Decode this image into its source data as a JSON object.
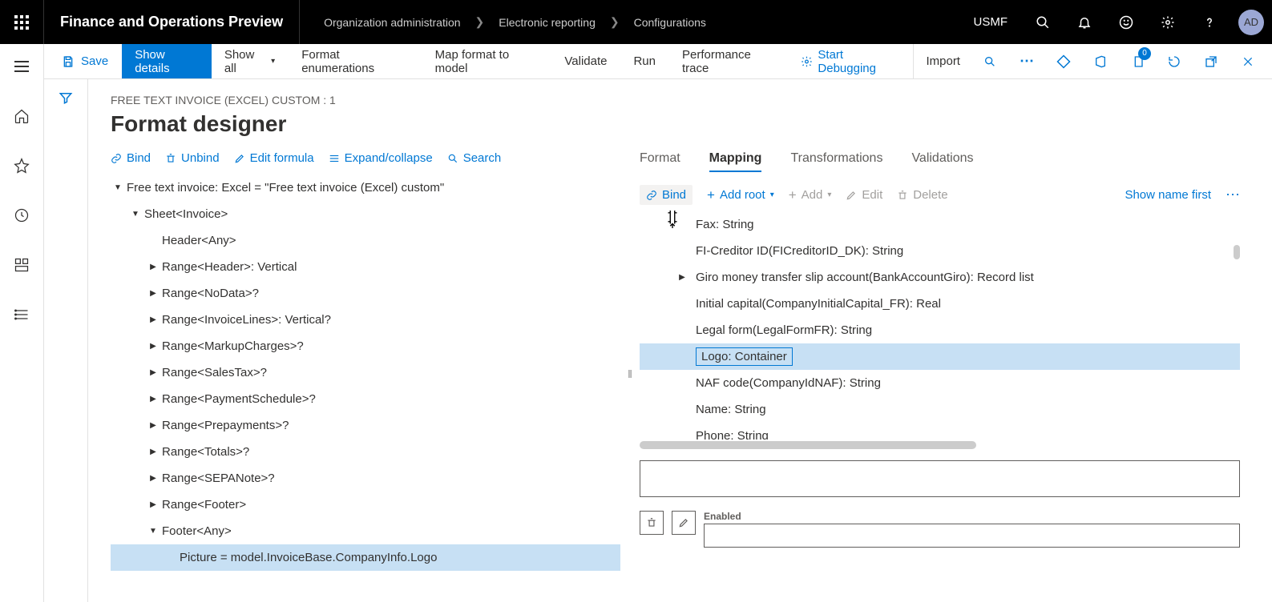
{
  "app": {
    "title": "Finance and Operations Preview",
    "entity": "USMF",
    "avatar": "AD",
    "breadcrumb": [
      "Organization administration",
      "Electronic reporting",
      "Configurations"
    ]
  },
  "cmdbar": {
    "save": "Save",
    "show_details": "Show details",
    "show_all": "Show all",
    "format_enum": "Format enumerations",
    "map_model": "Map format to model",
    "validate": "Validate",
    "run": "Run",
    "perf": "Performance trace",
    "start_debug": "Start Debugging",
    "import": "Import",
    "badge_count": "0"
  },
  "page": {
    "context": "FREE TEXT INVOICE (EXCEL) CUSTOM : 1",
    "title": "Format designer"
  },
  "left_toolbar": {
    "bind": "Bind",
    "unbind": "Unbind",
    "edit_formula": "Edit formula",
    "expand": "Expand/collapse",
    "search": "Search"
  },
  "format_tree": [
    {
      "indent": 0,
      "caret": "down",
      "label": "Free text invoice: Excel = \"Free text invoice (Excel) custom\"",
      "sel": false
    },
    {
      "indent": 1,
      "caret": "down",
      "label": "Sheet<Invoice>",
      "sel": false
    },
    {
      "indent": 2,
      "caret": "",
      "label": "Header<Any>",
      "sel": false
    },
    {
      "indent": 2,
      "caret": "right",
      "label": "Range<Header>: Vertical",
      "sel": false
    },
    {
      "indent": 2,
      "caret": "right",
      "label": "Range<NoData>?",
      "sel": false
    },
    {
      "indent": 2,
      "caret": "right",
      "label": "Range<InvoiceLines>: Vertical?",
      "sel": false
    },
    {
      "indent": 2,
      "caret": "right",
      "label": "Range<MarkupCharges>?",
      "sel": false
    },
    {
      "indent": 2,
      "caret": "right",
      "label": "Range<SalesTax>?",
      "sel": false
    },
    {
      "indent": 2,
      "caret": "right",
      "label": "Range<PaymentSchedule>?",
      "sel": false
    },
    {
      "indent": 2,
      "caret": "right",
      "label": "Range<Prepayments>?",
      "sel": false
    },
    {
      "indent": 2,
      "caret": "right",
      "label": "Range<Totals>?",
      "sel": false
    },
    {
      "indent": 2,
      "caret": "right",
      "label": "Range<SEPANote>?",
      "sel": false
    },
    {
      "indent": 2,
      "caret": "right",
      "label": "Range<Footer>",
      "sel": false
    },
    {
      "indent": 2,
      "caret": "down",
      "label": "Footer<Any>",
      "sel": false
    },
    {
      "indent": 3,
      "caret": "",
      "label": "Picture = model.InvoiceBase.CompanyInfo.Logo",
      "sel": true
    }
  ],
  "right_tabs": {
    "format": "Format",
    "mapping": "Mapping",
    "transformations": "Transformations",
    "validations": "Validations"
  },
  "right_toolbar": {
    "bind": "Bind",
    "add_root": "Add root",
    "add": "Add",
    "edit": "Edit",
    "delete": "Delete",
    "show_name_first": "Show name first"
  },
  "data_tree": [
    {
      "label": "Fax: String",
      "caret": "",
      "sel": false
    },
    {
      "label": "FI-Creditor ID(FICreditorID_DK): String",
      "caret": "",
      "sel": false
    },
    {
      "label": "Giro money transfer slip account(BankAccountGiro): Record list",
      "caret": "right",
      "sel": false
    },
    {
      "label": "Initial capital(CompanyInitialCapital_FR): Real",
      "caret": "",
      "sel": false
    },
    {
      "label": "Legal form(LegalFormFR): String",
      "caret": "",
      "sel": false
    },
    {
      "label": "Logo: Container",
      "caret": "",
      "sel": true
    },
    {
      "label": "NAF code(CompanyIdNAF): String",
      "caret": "",
      "sel": false
    },
    {
      "label": "Name: String",
      "caret": "",
      "sel": false
    },
    {
      "label": "Phone: String",
      "caret": "",
      "sel": false
    }
  ],
  "enabled_label": "Enabled"
}
